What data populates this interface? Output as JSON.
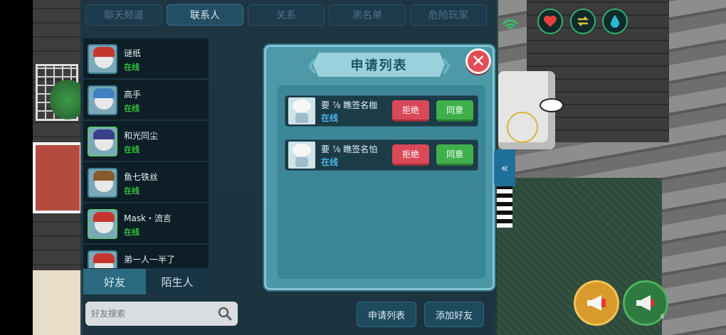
{
  "tabs": [
    {
      "label": "聊天频道",
      "active": false
    },
    {
      "label": "联系人",
      "active": true
    },
    {
      "label": "关系",
      "active": false
    },
    {
      "label": "黑名单",
      "active": false
    },
    {
      "label": "危险玩家",
      "active": false
    }
  ],
  "contacts": [
    {
      "name": "谜纸",
      "status": "在线",
      "hat_color": "#c5372e",
      "frame": "normal"
    },
    {
      "name": "高手",
      "status": "在线",
      "hat_color": "#3e80c1",
      "frame": "normal"
    },
    {
      "name": "和光同尘",
      "status": "在线",
      "hat_color": "#3a3f8a",
      "frame": "green"
    },
    {
      "name": "鱼七铁丝",
      "status": "在线",
      "hat_color": "#8b5a2b",
      "frame": "normal"
    },
    {
      "name": "Mask・流言",
      "status": "在线",
      "hat_color": "#c5372e",
      "frame": "green"
    },
    {
      "name": "弟一人一半了",
      "status": "在线",
      "hat_color": "#c5372e",
      "frame": "normal"
    }
  ],
  "bottom_tabs": [
    {
      "label": "好友",
      "active": true
    },
    {
      "label": "陌生人",
      "active": false
    }
  ],
  "search": {
    "placeholder": "好友搜索",
    "value": ""
  },
  "buttons": {
    "request_list": "申请列表",
    "add_friend": "添加好友"
  },
  "modal": {
    "title": "申请列表",
    "requests": [
      {
        "name": "要 ⅞ 瞧签名枷",
        "status": "在线",
        "reject_label": "拒绝",
        "agree_label": "同意"
      },
      {
        "name": "要 ⅞ 瞧签名怕",
        "status": "在线",
        "reject_label": "拒绝",
        "agree_label": "同意"
      }
    ]
  },
  "hud": {
    "icons": [
      "heart-icon",
      "swap-icon",
      "water-drop-icon"
    ],
    "mic_badge": "4"
  },
  "colors": {
    "accent": "#4c98a7",
    "online": "#31c23c",
    "reject": "#d9495a",
    "agree": "#3fb04a"
  }
}
